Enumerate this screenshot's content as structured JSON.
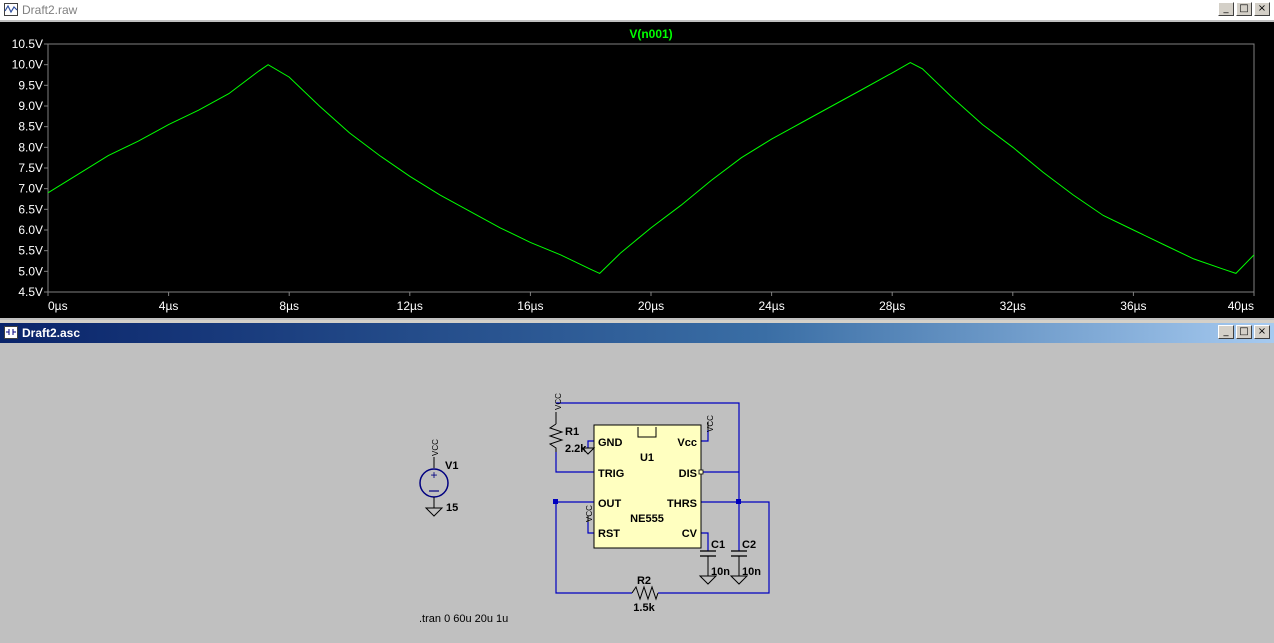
{
  "plot_window": {
    "title": "Draft2.raw",
    "buttons": [
      "_",
      "□",
      "×"
    ]
  },
  "schematic_window": {
    "title": "Draft2.asc",
    "buttons": [
      "_",
      "□",
      "×"
    ]
  },
  "chart_data": {
    "type": "line",
    "title": "V(n001)",
    "xlabel": "",
    "ylabel": "",
    "xlim": [
      0,
      40
    ],
    "ylim": [
      4.5,
      10.5
    ],
    "grid": false,
    "x_ticks": [
      "0µs",
      "4µs",
      "8µs",
      "12µs",
      "16µs",
      "20µs",
      "24µs",
      "28µs",
      "32µs",
      "36µs",
      "40µs"
    ],
    "y_ticks": [
      "10.5V",
      "10.0V",
      "9.5V",
      "9.0V",
      "8.5V",
      "8.0V",
      "7.5V",
      "7.0V",
      "6.5V",
      "6.0V",
      "5.5V",
      "5.0V",
      "4.5V"
    ],
    "series": [
      {
        "name": "V(n001)",
        "color": "#00ff00",
        "x": [
          0,
          1,
          2,
          3,
          4,
          5,
          6,
          7,
          7.3,
          8,
          9,
          10,
          11,
          12,
          13,
          14,
          15,
          16,
          17,
          18,
          18.3,
          19,
          20,
          21,
          22,
          23,
          24,
          25,
          26,
          27,
          28,
          28.6,
          29,
          30,
          31,
          32,
          33,
          34,
          35,
          36,
          37,
          38,
          39,
          39.4,
          40
        ],
        "values": [
          6.9,
          7.35,
          7.8,
          8.15,
          8.55,
          8.9,
          9.3,
          9.85,
          10.0,
          9.7,
          9.0,
          8.35,
          7.8,
          7.3,
          6.85,
          6.45,
          6.05,
          5.7,
          5.4,
          5.05,
          4.95,
          5.45,
          6.05,
          6.6,
          7.2,
          7.75,
          8.2,
          8.6,
          9.0,
          9.4,
          9.8,
          10.05,
          9.9,
          9.2,
          8.55,
          8.0,
          7.4,
          6.85,
          6.35,
          6.0,
          5.65,
          5.3,
          5.05,
          4.95,
          5.4
        ]
      }
    ]
  },
  "schematic": {
    "components": [
      {
        "ref": "V1",
        "value": "15",
        "power": "VCC"
      },
      {
        "ref": "R1",
        "value": "2.2k",
        "power": "VCC"
      },
      {
        "ref": "R2",
        "value": "1.5k"
      },
      {
        "ref": "C1",
        "value": "10n"
      },
      {
        "ref": "C2",
        "value": "10n"
      },
      {
        "ref": "U1",
        "value": "NE555"
      }
    ],
    "u1_pins": {
      "gnd": "GND",
      "vcc": "Vcc",
      "trig": "TRIG",
      "dis": "DIS",
      "out": "OUT",
      "thrs": "THRS",
      "rst": "RST",
      "cv": "CV"
    },
    "vcc_labels": {
      "v1": "VCC",
      "r1": "VCC",
      "u1": "VCC",
      "rst": "VCC"
    },
    "directive": ".tran 0 60u 20u 1u"
  }
}
